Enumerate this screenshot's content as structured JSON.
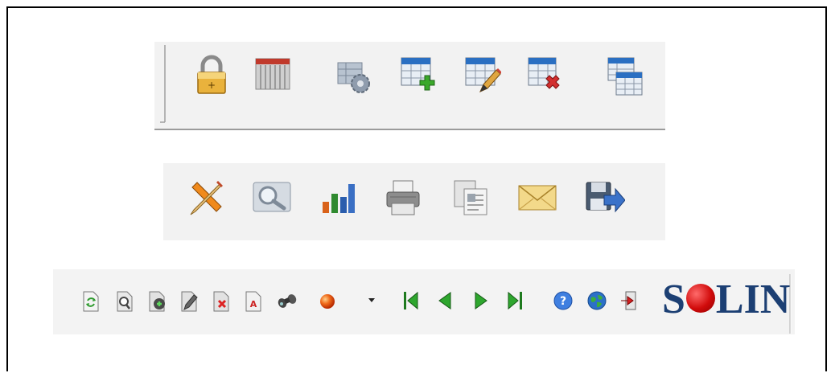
{
  "toolbars": [
    {
      "name": "data-toolbar",
      "buttons": [
        {
          "id": "lock",
          "icon": "lock-icon",
          "tooltip": ""
        },
        {
          "id": "table",
          "icon": "table-icon"
        },
        {
          "id": "table-settings",
          "icon": "table-settings-icon"
        },
        {
          "id": "table-add",
          "icon": "table-add-icon"
        },
        {
          "id": "table-edit",
          "icon": "table-edit-icon"
        },
        {
          "id": "table-delete",
          "icon": "table-delete-icon"
        },
        {
          "id": "table-copy",
          "icon": "table-copy-icon"
        }
      ]
    },
    {
      "name": "report-toolbar",
      "buttons": [
        {
          "id": "tools",
          "icon": "tools-icon"
        },
        {
          "id": "preview",
          "icon": "magnifier-icon"
        },
        {
          "id": "chart",
          "icon": "bar-chart-icon"
        },
        {
          "id": "print",
          "icon": "printer-icon"
        },
        {
          "id": "copy",
          "icon": "copy-document-icon"
        },
        {
          "id": "email",
          "icon": "envelope-icon"
        },
        {
          "id": "export",
          "icon": "save-export-icon"
        }
      ]
    },
    {
      "name": "navigation-toolbar",
      "buttons": [
        {
          "id": "refresh",
          "icon": "refresh-document-icon"
        },
        {
          "id": "find",
          "icon": "find-document-icon"
        },
        {
          "id": "new",
          "icon": "new-document-icon"
        },
        {
          "id": "edit",
          "icon": "edit-document-icon"
        },
        {
          "id": "delete",
          "icon": "delete-document-icon"
        },
        {
          "id": "text",
          "icon": "text-document-icon"
        },
        {
          "id": "search",
          "icon": "binoculars-icon"
        },
        {
          "id": "status",
          "icon": "status-ball-icon"
        },
        {
          "id": "status-menu",
          "icon": "dropdown-arrow-icon"
        },
        {
          "id": "first",
          "icon": "first-record-icon"
        },
        {
          "id": "prev",
          "icon": "previous-record-icon"
        },
        {
          "id": "next",
          "icon": "next-record-icon"
        },
        {
          "id": "last",
          "icon": "last-record-icon"
        },
        {
          "id": "help",
          "icon": "help-icon"
        },
        {
          "id": "web",
          "icon": "globe-icon"
        },
        {
          "id": "exit",
          "icon": "exit-icon"
        }
      ],
      "logo": {
        "prefix": "S",
        "suffix": "LIN",
        "ball_color": "#d10b0b",
        "text_color": "#1c3f73"
      }
    }
  ]
}
